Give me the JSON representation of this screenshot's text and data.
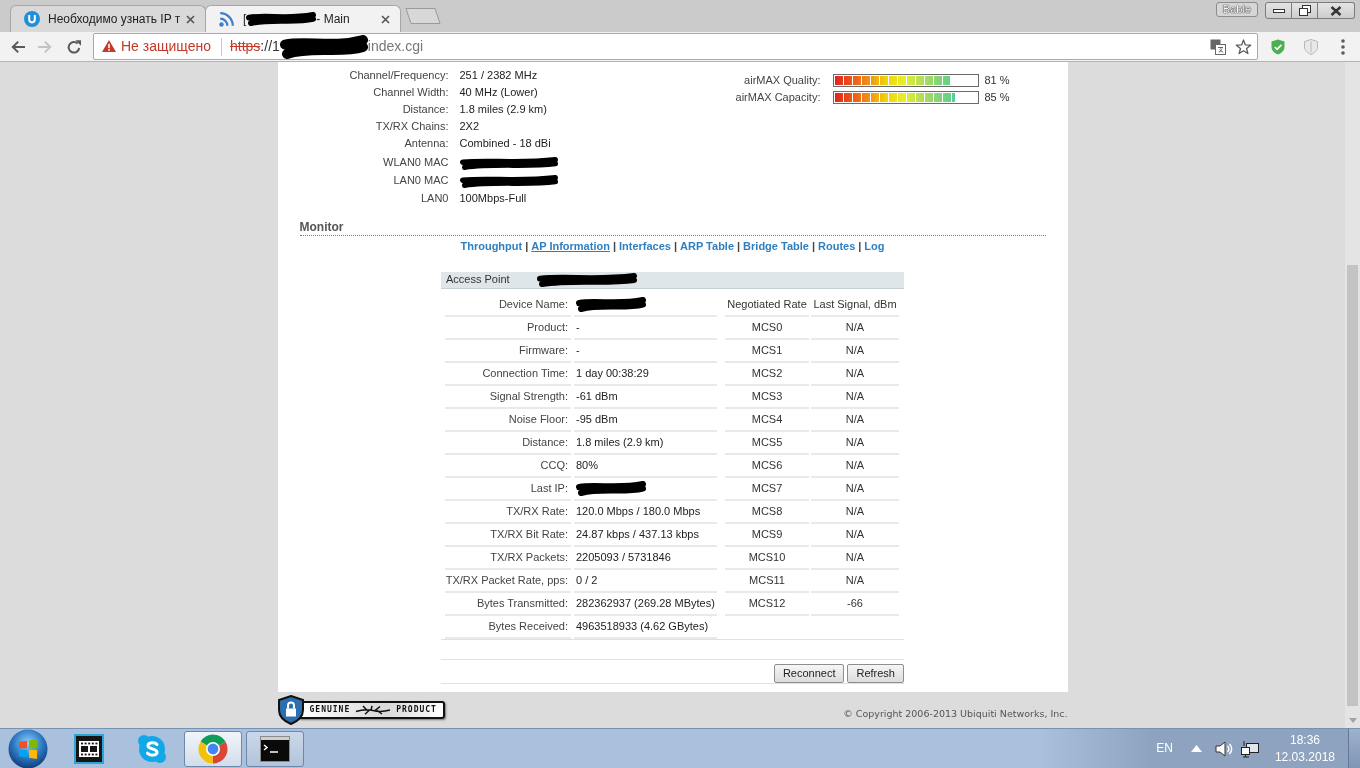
{
  "browser": {
    "tabs": [
      {
        "kind": "web",
        "title": "Необходимо узнать IP т",
        "selected": false,
        "redacted": false
      },
      {
        "kind": "device",
        "title_prefix": "[",
        "title": "- Main",
        "selected": true,
        "redacted": true
      }
    ],
    "profile": "Bable",
    "nav_buttons": [
      {
        "kind": "back",
        "disabled": false
      },
      {
        "kind": "forward",
        "disabled": true
      },
      {
        "kind": "reload",
        "disabled": false
      }
    ],
    "address_bar": {
      "security": "Не защищено",
      "scheme": "https",
      "url_start": "://1",
      "url_end": "index.cgi",
      "redacted": true
    }
  },
  "device_info": {
    "wireless": [
      {
        "label": "Channel/Frequency:",
        "value": "251 / 2382 MHz"
      },
      {
        "label": "Channel Width:",
        "value": "40 MHz (Lower)"
      },
      {
        "label": "Distance:",
        "value": "1.8 miles (2.9 km)"
      },
      {
        "label": "TX/RX Chains:",
        "value": "2X2"
      },
      {
        "label": "Antenna:",
        "value": "Combined - 18 dBi"
      }
    ],
    "interfaces": [
      {
        "label": "WLAN0 MAC",
        "redacted": true
      },
      {
        "label": "LAN0 MAC",
        "redacted": true
      },
      {
        "label": "LAN0",
        "value": "100Mbps-Full",
        "redacted": false
      }
    ],
    "airmax": [
      {
        "label": "airMAX Quality:",
        "level": 0.81,
        "reading": "81 %"
      },
      {
        "label": "airMAX Capacity:",
        "level": 0.85,
        "reading": "85 %"
      }
    ]
  },
  "monitor": {
    "title": "Monitor",
    "separator": "|",
    "links": [
      {
        "label": "Throughput",
        "selected": false
      },
      {
        "label": "AP Information",
        "selected": true
      },
      {
        "label": "Interfaces",
        "selected": false
      },
      {
        "label": "ARP Table",
        "selected": false
      },
      {
        "label": "Bridge Table",
        "selected": false
      },
      {
        "label": "Routes",
        "selected": false
      },
      {
        "label": "Log",
        "selected": false
      }
    ]
  },
  "access_point": {
    "label": "Access Point",
    "redacted": true
  },
  "station": [
    {
      "label": "Device Name:",
      "redacted": true
    },
    {
      "label": "Product:",
      "value": "-",
      "redacted": false
    },
    {
      "label": "Firmware:",
      "value": "-",
      "redacted": false
    },
    {
      "label": "Connection Time:",
      "value": "1 day 00:38:29",
      "redacted": false
    },
    {
      "label": "Signal Strength:",
      "value": "-61 dBm",
      "redacted": false
    },
    {
      "label": "Noise Floor:",
      "value": "-95 dBm",
      "redacted": false
    },
    {
      "label": "Distance:",
      "value": "1.8 miles (2.9 km)",
      "redacted": false
    },
    {
      "label": "CCQ:",
      "value": "80%",
      "redacted": false
    },
    {
      "label": "Last IP:",
      "redacted": true
    },
    {
      "label": "TX/RX Rate:",
      "value": "120.0 Mbps / 180.0 Mbps",
      "redacted": false
    },
    {
      "label": "TX/RX Bit Rate:",
      "value": "24.87 kbps / 437.13 kbps",
      "redacted": false
    },
    {
      "label": "TX/RX Packets:",
      "value": "2205093 / 5731846",
      "redacted": false
    },
    {
      "label": "TX/RX Packet Rate, pps:",
      "value": "0 / 2",
      "redacted": false
    },
    {
      "label": "Bytes Transmitted:",
      "value": "282362937 (269.28 MBytes)",
      "redacted": false
    },
    {
      "label": "Bytes Received:",
      "value": "4963518933 (4.62 GBytes)",
      "redacted": false
    }
  ],
  "rates": {
    "columns": [
      "Negotiated Rate",
      "Last Signal, dBm"
    ],
    "rows": [
      {
        "rate": "MCS0",
        "signal": "N/A"
      },
      {
        "rate": "MCS1",
        "signal": "N/A"
      },
      {
        "rate": "MCS2",
        "signal": "N/A"
      },
      {
        "rate": "MCS3",
        "signal": "N/A"
      },
      {
        "rate": "MCS4",
        "signal": "N/A"
      },
      {
        "rate": "MCS5",
        "signal": "N/A"
      },
      {
        "rate": "MCS6",
        "signal": "N/A"
      },
      {
        "rate": "MCS7",
        "signal": "N/A"
      },
      {
        "rate": "MCS8",
        "signal": "N/A"
      },
      {
        "rate": "MCS9",
        "signal": "N/A"
      },
      {
        "rate": "MCS10",
        "signal": "N/A"
      },
      {
        "rate": "MCS11",
        "signal": "N/A"
      },
      {
        "rate": "MCS12",
        "signal": "-66"
      }
    ]
  },
  "buttons": [
    "Reconnect",
    "Refresh"
  ],
  "footer": {
    "badge": [
      "GENUINE",
      "PRODUCT"
    ],
    "copyright": "© Copyright 2006-2013 Ubiquiti Networks, Inc."
  },
  "taskbar": {
    "apps": [
      {
        "kind": "media",
        "running": false,
        "selected": false
      },
      {
        "kind": "chat",
        "running": false,
        "selected": false
      },
      {
        "kind": "browser",
        "running": true,
        "selected": true
      },
      {
        "kind": "terminal",
        "running": true,
        "selected": false
      }
    ],
    "language": "EN",
    "time": "18:36",
    "date": "12.03.2018"
  }
}
